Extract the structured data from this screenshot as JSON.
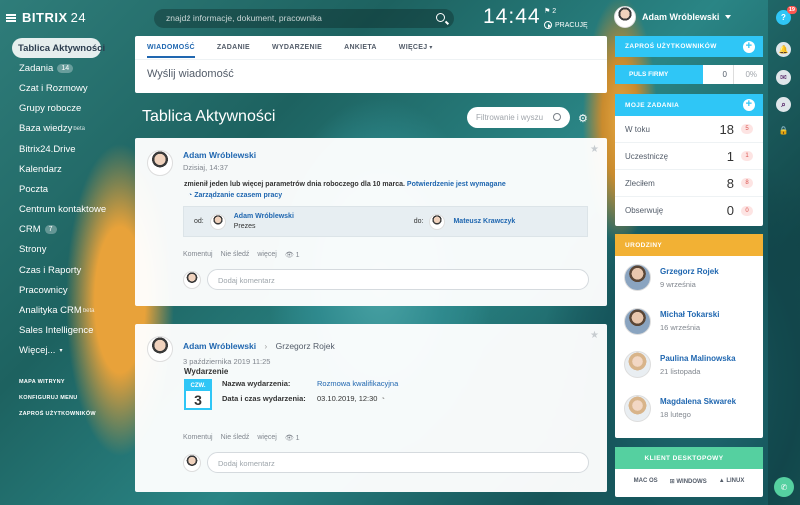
{
  "app": {
    "logo": "BITRIX",
    "logo_num": "24"
  },
  "sidebar": {
    "items": [
      {
        "label": "Tablica Aktywności",
        "active": true
      },
      {
        "label": "Zadania",
        "count": "14"
      },
      {
        "label": "Czat i Rozmowy"
      },
      {
        "label": "Grupy robocze"
      },
      {
        "label": "Baza wiedzy",
        "sup": "beta"
      },
      {
        "label": "Bitrix24.Drive"
      },
      {
        "label": "Kalendarz"
      },
      {
        "label": "Poczta"
      },
      {
        "label": "Centrum kontaktowe"
      },
      {
        "label": "CRM",
        "count": "7"
      },
      {
        "label": "Strony"
      },
      {
        "label": "Czas i Raporty"
      },
      {
        "label": "Pracownicy"
      },
      {
        "label": "Analityka CRM",
        "sup": "beta"
      },
      {
        "label": "Sales Intelligence"
      },
      {
        "label": "Więcej...",
        "caret": "▾"
      }
    ],
    "bottom": [
      "MAPA WITRYNY",
      "KONFIGURUJ MENU",
      "ZAPROŚ UŻYTKOWNIKÓW"
    ]
  },
  "header": {
    "search_placeholder": "znajdź informacje, dokument, pracownika",
    "time": "14:44",
    "flag_count": "2",
    "work_label": "PRACUJĘ",
    "user_name": "Adam Wróblewski"
  },
  "right_bar": {
    "help": "?",
    "notif_badge": "19"
  },
  "composer": {
    "tabs": [
      "WIADOMOŚĆ",
      "ZADANIE",
      "WYDARZENIE",
      "ANKIETA",
      "WIĘCEJ"
    ],
    "text": "Wyślij wiadomość"
  },
  "page_title": "Tablica Aktywności",
  "filter_placeholder": "Filtrowanie i wyszu",
  "post1": {
    "author": "Adam Wróblewski",
    "date": "Dzisiaj, 14:37",
    "text": "zmienił jeden lub więcej parametrów dnia roboczego dla 10 marca.",
    "text_link": "Potwierdzenie jest wymagane",
    "link2": "Zarządzanie czasem pracy",
    "from_label": "od:",
    "from_name": "Adam Wróblewski",
    "from_pos": "Prezes",
    "to_label": "do:",
    "to_name": "Mateusz Krawczyk",
    "actions": [
      "Komentuj",
      "Nie śledź",
      "więcej"
    ],
    "views": "1",
    "comment_placeholder": "Dodaj komentarz"
  },
  "post2": {
    "author": "Adam Wróblewski",
    "recipient": "Grzegorz Rojek",
    "date": "3 października 2019 11:25",
    "event_title": "Wydarzenie",
    "cal_month": "CZW.",
    "cal_day": "3",
    "name_label": "Nazwa wydarzenia:",
    "name_value": "Rozmowa kwalifikacyjna",
    "date_label": "Data i czas wydarzenia:",
    "date_value": "03.10.2019, 12:30",
    "actions": [
      "Komentuj",
      "Nie śledź",
      "więcej"
    ],
    "views": "1",
    "comment_placeholder": "Dodaj komentarz"
  },
  "invite": {
    "label": "ZAPROŚ UŻYTKOWNIKÓW"
  },
  "pulse": {
    "label": "PULS FIRMY",
    "value": "0",
    "percent": "0%"
  },
  "tasks": {
    "title": "MOJE ZADANIA",
    "rows": [
      {
        "name": "W toku",
        "count": "18",
        "badge": "5"
      },
      {
        "name": "Uczestniczę",
        "count": "1",
        "badge": "1"
      },
      {
        "name": "Zleciłem",
        "count": "8",
        "badge": "8"
      },
      {
        "name": "Obserwuję",
        "count": "0",
        "badge": "0"
      }
    ]
  },
  "birthdays": {
    "title": "URODZINY",
    "rows": [
      {
        "name": "Grzegorz Rojek",
        "date": "9 września"
      },
      {
        "name": "Michał Tokarski",
        "date": "16 września"
      },
      {
        "name": "Paulina Malinowska",
        "date": "21 listopada"
      },
      {
        "name": "Magdalena Skwarek",
        "date": "18 lutego"
      }
    ]
  },
  "desktop": {
    "title": "KLIENT DESKTOPOWY",
    "os": [
      "MAC OS",
      "WINDOWS",
      "LINUX"
    ]
  },
  "colors": {
    "accent": "#2fc6f6",
    "link": "#2067b0",
    "birthday": "#f2b134",
    "desktop": "#55d0a0"
  }
}
